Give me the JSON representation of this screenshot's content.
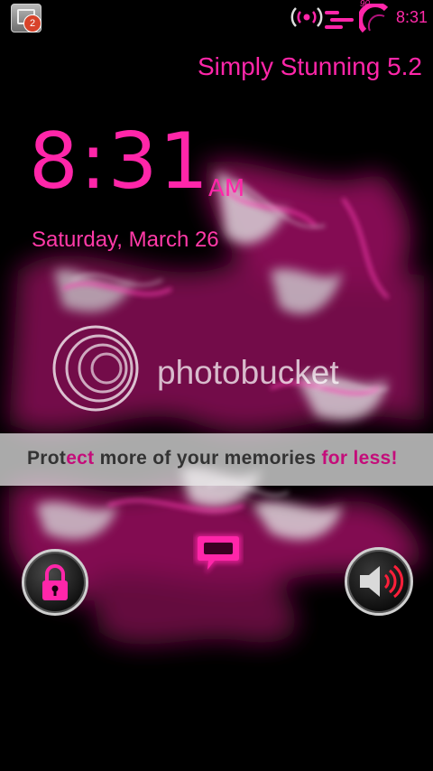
{
  "status_bar": {
    "notification_count": "2",
    "battery_level": "90",
    "time": "8:31",
    "icons": [
      "notification-icon",
      "signal-icon",
      "data-activity-icon",
      "battery-gauge-icon"
    ]
  },
  "theme_title": "Simply Stunning 5.2",
  "lockscreen": {
    "clock": "8:31",
    "ampm": "AM",
    "date": "Saturday, March 26"
  },
  "watermark": {
    "brand": "photobucket"
  },
  "promo": {
    "text_part1": "Prot",
    "text_accent1": "ect",
    "text_part2": " more of your memories ",
    "text_accent2": "for less!"
  },
  "controls": {
    "left": "lock-icon",
    "center": "sms-icon",
    "right": "speaker-icon"
  },
  "colors": {
    "accent": "#ff26a9",
    "background": "#000000"
  }
}
